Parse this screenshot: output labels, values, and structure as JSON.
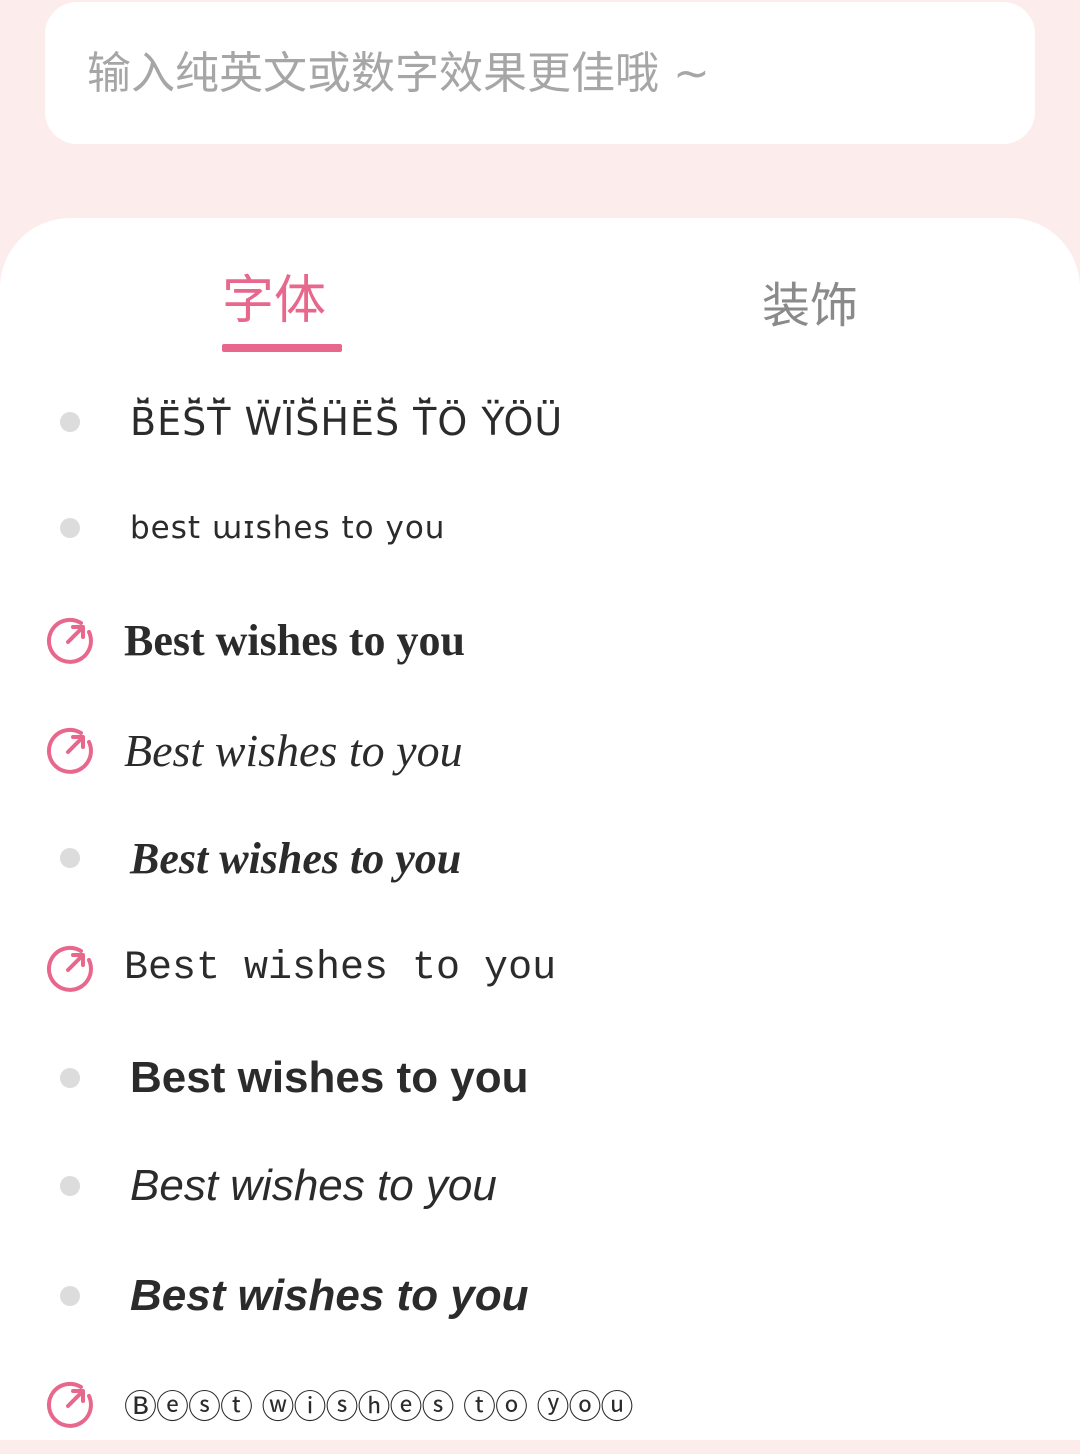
{
  "search": {
    "placeholder": "输入纯英文或数字效果更佳哦 ~",
    "value": ""
  },
  "tabs": [
    {
      "label": "字体",
      "active": true
    },
    {
      "label": "装饰",
      "active": false
    }
  ],
  "font_list": [
    {
      "text": "B̈̆ËS̈̆T̈̆ ẄÏS̈̆ḦËS̈̆ T̈̆Ö ŸÖÜ",
      "marker": "dot-icon"
    },
    {
      "text": "best ɯɪshes to you",
      "marker": "dot-icon"
    },
    {
      "text": "Best wishes to you",
      "marker": "share-arrow-icon"
    },
    {
      "text": "Best wishes to you",
      "marker": "share-arrow-icon"
    },
    {
      "text": "Best wishes to you",
      "marker": "dot-icon"
    },
    {
      "text": "Best wishes to you",
      "marker": "share-arrow-icon"
    },
    {
      "text": "Best wishes to you",
      "marker": "dot-icon"
    },
    {
      "text": "Best wishes to you",
      "marker": "dot-icon"
    },
    {
      "text": "Best wishes to you",
      "marker": "dot-icon"
    },
    {
      "text": "Ⓑⓔⓢⓣ ⓦⓘⓢⓗⓔⓢ ⓣⓞ ⓨⓞⓤ",
      "marker": "share-arrow-icon"
    }
  ],
  "colors": {
    "accent": "#e8688d",
    "background": "#fdecec",
    "dot": "#dcdcdc",
    "inactive_tab": "#8a8a8a",
    "placeholder": "#a6a6a6"
  }
}
